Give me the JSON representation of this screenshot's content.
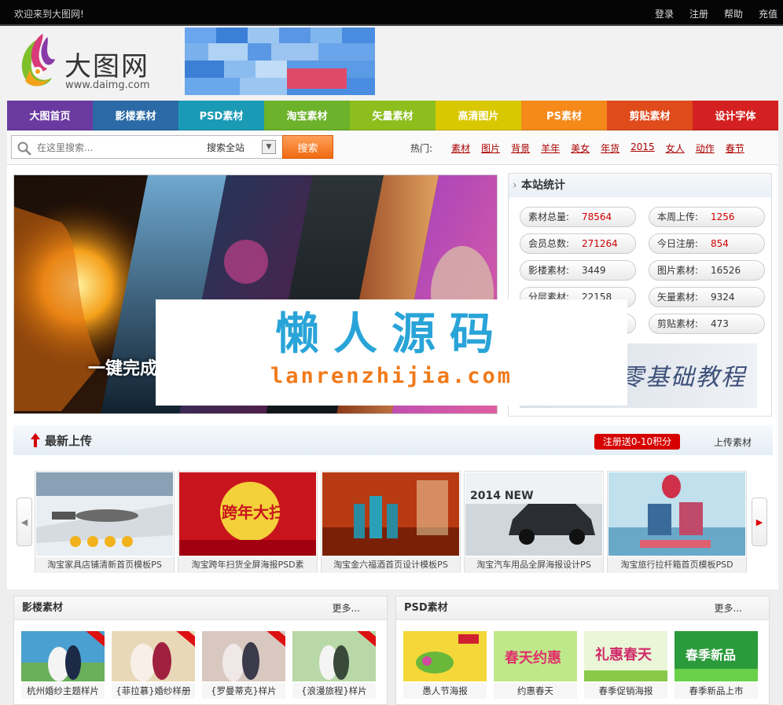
{
  "topbar": {
    "welcome": "欢迎来到大图网!",
    "links": [
      "登录",
      "注册",
      "帮助",
      "充值"
    ]
  },
  "logo": {
    "name": "大图网",
    "url": "www.daimg.com"
  },
  "nav": {
    "items": [
      {
        "label": "大图首页",
        "color": "#6b3aa0"
      },
      {
        "label": "影楼素材",
        "color": "#2b6aa6"
      },
      {
        "label": "PSD素材",
        "color": "#1b9ab6"
      },
      {
        "label": "淘宝素材",
        "color": "#6cb22a"
      },
      {
        "label": "矢量素材",
        "color": "#8cbe1e"
      },
      {
        "label": "高清图片",
        "color": "#d9c800"
      },
      {
        "label": "PS素材",
        "color": "#f5891a"
      },
      {
        "label": "剪贴素材",
        "color": "#e04b1c"
      },
      {
        "label": "设计字体",
        "color": "#d42020"
      }
    ]
  },
  "search": {
    "placeholder": "在这里搜索...",
    "scope": "搜索全站",
    "button": "搜索",
    "hot_label": "热门:",
    "hot_links": [
      "素材",
      "图片",
      "背景",
      "羊年",
      "美女",
      "年货",
      "2015",
      "女人",
      "动作",
      "春节"
    ]
  },
  "banner": {
    "slogan": "一键完成"
  },
  "stats": {
    "title": "本站统计",
    "items": [
      {
        "label": "素材总量:",
        "value": "78564",
        "red": true
      },
      {
        "label": "本周上传:",
        "value": "1256",
        "red": true
      },
      {
        "label": "会员总数:",
        "value": "271264",
        "red": true
      },
      {
        "label": "今日注册:",
        "value": "854",
        "red": true
      },
      {
        "label": "影楼素材:",
        "value": "3449",
        "red": false
      },
      {
        "label": "图片素材:",
        "value": "16526",
        "red": false
      },
      {
        "label": "分层素材:",
        "value": "22158",
        "red": false
      },
      {
        "label": "矢量素材:",
        "value": "9324",
        "red": false
      },
      {
        "label": "",
        "value": "",
        "red": false
      },
      {
        "label": "剪贴素材:",
        "value": "473",
        "red": false
      }
    ],
    "promo": "零基础教程"
  },
  "watermark": {
    "cn": "懒人源码",
    "en": "lanrenzhijia.com"
  },
  "uploads": {
    "title": "最新上传",
    "register_badge": "注册送0-10积分",
    "upload_link": "上传素材",
    "items": [
      {
        "caption": "淘宝家具店铺清新首页模板PS"
      },
      {
        "caption": "淘宝跨年扫货全屏海报PSD素"
      },
      {
        "caption": "淘宝金六福酒首页设计模板PS"
      },
      {
        "caption": "淘宝汽车用品全屏海报设计PS"
      },
      {
        "caption": "淘宝旅行拉杆箱首页模板PSD"
      }
    ],
    "thumb_texts": {
      "kuanian": "跨年大扫货",
      "car": "2014 NEW"
    }
  },
  "sections": [
    {
      "title": "影楼素材",
      "more": "更多...",
      "items": [
        "杭州婚纱主题样片",
        "{菲拉慕}婚纱样册",
        "{罗曼蒂克}样片",
        "{浪漫旅程}样片"
      ]
    },
    {
      "title": "PSD素材",
      "more": "更多...",
      "items": [
        "愚人节海报",
        "约惠春天",
        "春季促销海报",
        "春季新品上市"
      ]
    }
  ],
  "psd_thumb_texts": [
    "春天约惠",
    "礼惠春天",
    "春季新品"
  ]
}
